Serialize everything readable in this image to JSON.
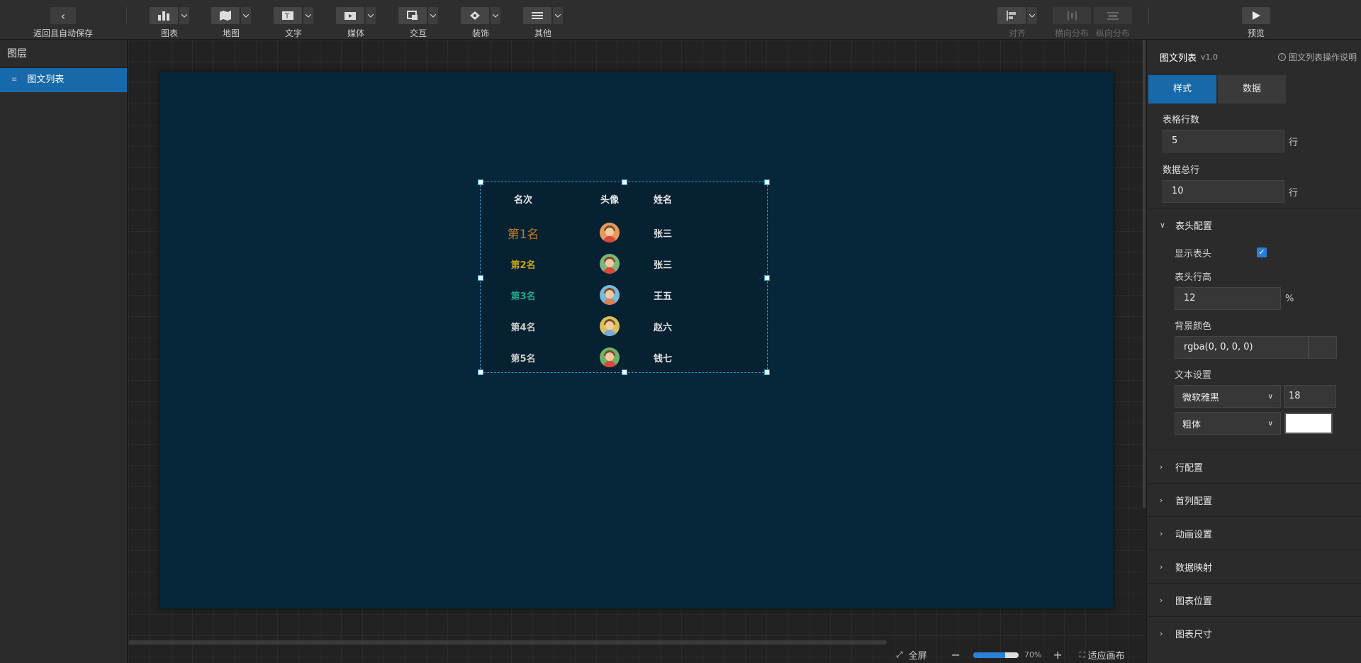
{
  "toolbar": {
    "back_label": "返回且自动保存",
    "chart_label": "图表",
    "map_label": "地图",
    "text_label": "文字",
    "media_label": "媒体",
    "interact_label": "交互",
    "decor_label": "装饰",
    "other_label": "其他",
    "align_label": "对齐",
    "hdist_label": "横向分布",
    "vdist_label": "纵向分布",
    "preview_label": "预览"
  },
  "layers": {
    "title": "图层",
    "items": [
      {
        "label": "图文列表"
      }
    ]
  },
  "widget": {
    "headers": {
      "rank": "名次",
      "avatar": "头像",
      "name": "姓名"
    },
    "rows": [
      {
        "rank": "第1名",
        "name": "张三",
        "rank_color": "#c07a20",
        "avatar_bg": "#e39b5b",
        "shirt": "#d9483b"
      },
      {
        "rank": "第2名",
        "name": "张三",
        "rank_color": "#c9a514",
        "avatar_bg": "#7bb77a",
        "shirt": "#d9483b"
      },
      {
        "rank": "第3名",
        "name": "王五",
        "rank_color": "#19a88a",
        "avatar_bg": "#7ab9d8",
        "shirt": "#d97f5a"
      },
      {
        "rank": "第4名",
        "name": "赵六",
        "rank_color": "#cfcfcf",
        "avatar_bg": "#d7c25a",
        "shirt": "#7aa9d6"
      },
      {
        "rank": "第5名",
        "name": "钱七",
        "rank_color": "#cfcfcf",
        "avatar_bg": "#6fb06a",
        "shirt": "#d9483b"
      }
    ]
  },
  "props": {
    "title": "图文列表",
    "version": "v1.0",
    "help": "图文列表操作说明",
    "tabs": [
      "样式",
      "数据"
    ],
    "table_rows_label": "表格行数",
    "table_rows_value": "5",
    "total_rows_label": "数据总行",
    "total_rows_value": "10",
    "unit_row": "行",
    "header_section": "表头配置",
    "show_header_label": "显示表头",
    "header_height_label": "表头行高",
    "header_height_value": "12",
    "percent": "%",
    "bg_color_label": "背景颜色",
    "bg_color_value": "rgba(0, 0, 0, 0)",
    "text_settings_label": "文本设置",
    "font_family": "微软雅黑",
    "font_size": "18",
    "font_weight": "粗体",
    "sections": [
      "行配置",
      "首列配置",
      "动画设置",
      "数据映射",
      "图表位置",
      "图表尺寸"
    ]
  },
  "bottom": {
    "fullscreen": "全屏",
    "zoom": "70%",
    "zoom_fraction": 0.7,
    "fit": "适应画布"
  },
  "colors": {
    "accent": "#1769aa",
    "screen_bg": "#06263a"
  }
}
